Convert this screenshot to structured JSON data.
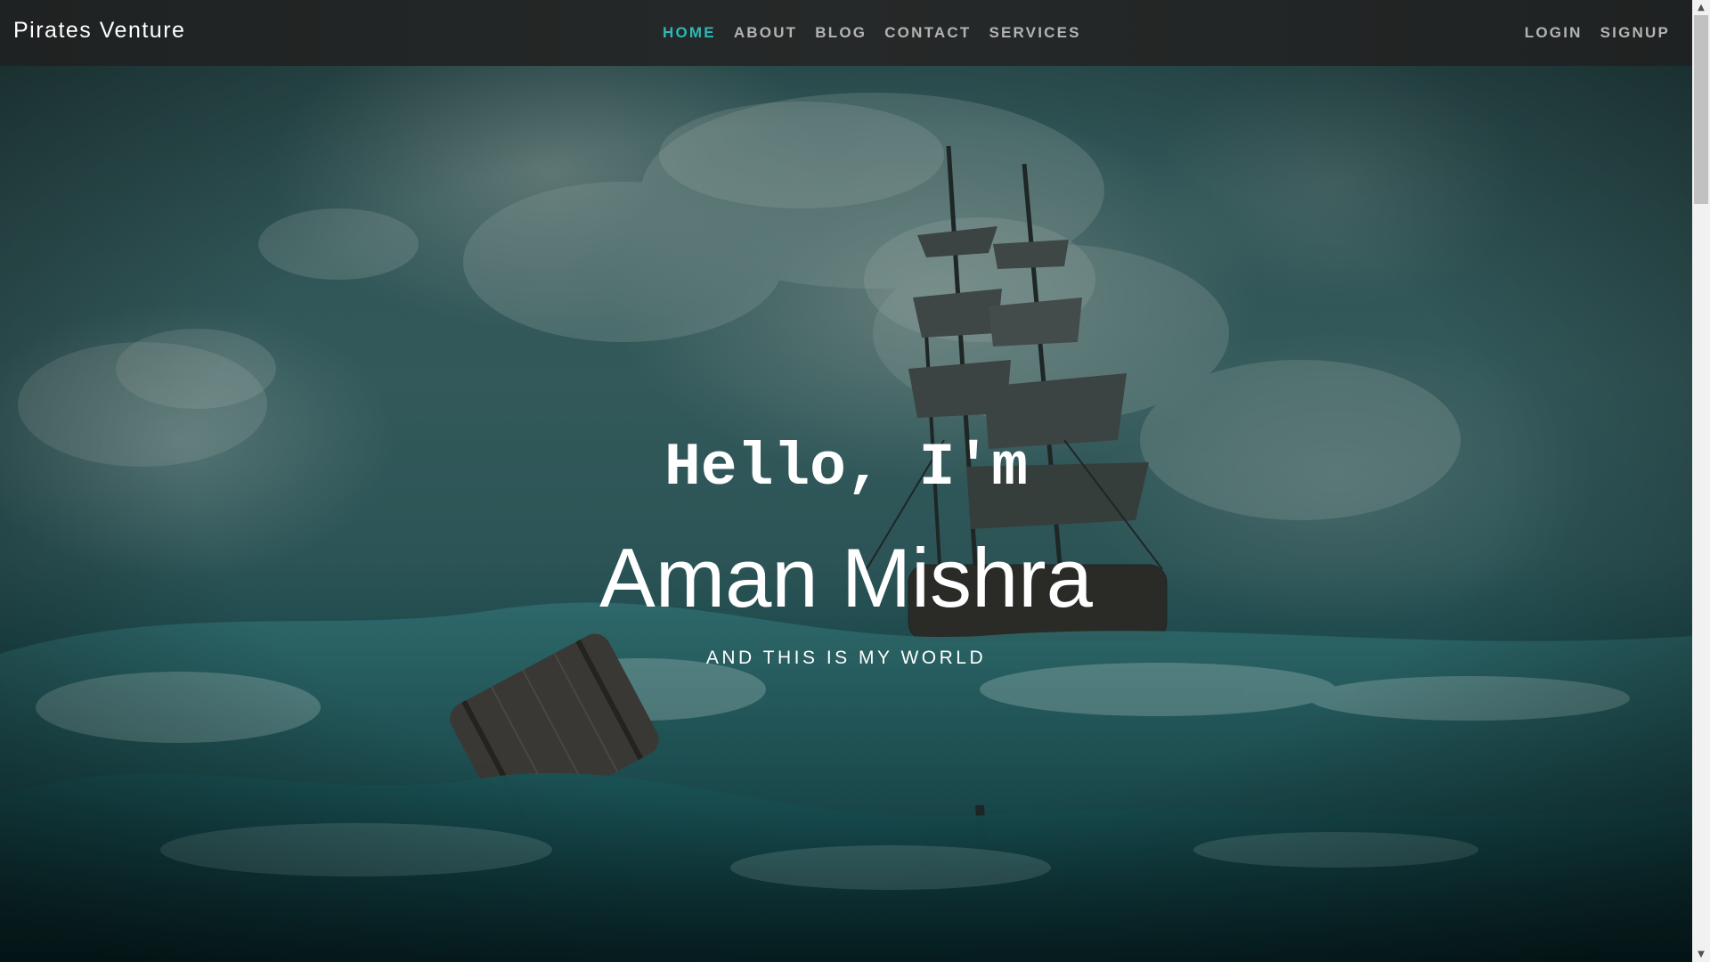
{
  "navbar": {
    "brand": "Pirates Venture",
    "links": [
      {
        "label": "HOME",
        "active": true
      },
      {
        "label": "ABOUT",
        "active": false
      },
      {
        "label": "BLOG",
        "active": false
      },
      {
        "label": "CONTACT",
        "active": false
      },
      {
        "label": "SERVICES",
        "active": false
      }
    ],
    "auth": [
      {
        "label": "LOGIN"
      },
      {
        "label": "SIGNUP"
      }
    ]
  },
  "hero": {
    "greeting": "Hello, I'm",
    "name": "Aman Mishra",
    "tagline": "AND THIS IS MY WORLD"
  },
  "colors": {
    "accent": "#2fb8b4",
    "nav_background": "#232626",
    "nav_text": "#b3b3b3",
    "hero_text": "#ffffff",
    "sea": "#0f3a3d"
  },
  "icons": {
    "scroll_up": "chevron-up-icon",
    "scroll_down": "chevron-down-icon"
  }
}
